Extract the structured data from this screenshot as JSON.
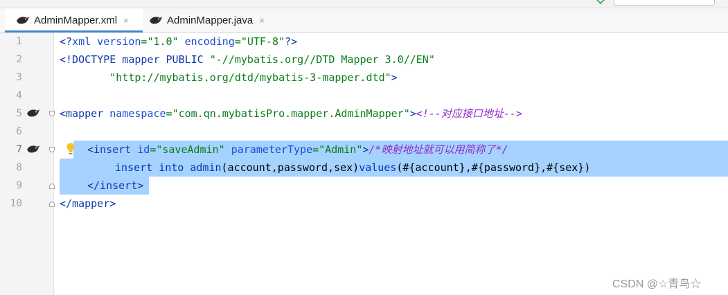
{
  "tabs": [
    {
      "label": "AdminMapper.xml",
      "active": true,
      "close": "×"
    },
    {
      "label": "AdminMapper.java",
      "active": false,
      "close": "×"
    }
  ],
  "top_widget": {
    "label": ""
  },
  "gutter": {
    "line_numbers": [
      "1",
      "2",
      "3",
      "4",
      "5",
      "6",
      "7",
      "8",
      "9",
      "10"
    ]
  },
  "code": {
    "l1": {
      "a": "<?",
      "b": "xml version",
      "c": "=",
      "d": "\"1.0\"",
      "e": " encoding",
      "f": "=",
      "g": "\"UTF-8\"",
      "h": "?>"
    },
    "l2": {
      "a": "<!DOCTYPE mapper PUBLIC ",
      "b": "\"-//mybatis.org//DTD Mapper 3.0//EN\""
    },
    "l3": {
      "a": "        ",
      "b": "\"http://mybatis.org/dtd/mybatis-3-mapper.dtd\"",
      "c": ">"
    },
    "l5": {
      "a": "<mapper",
      "b": " namespace",
      "c": "=",
      "d": "\"com.qn.mybatisPro.mapper.AdminMapper\"",
      "e": ">",
      "f": "<!--对应接口地址-->"
    },
    "l7": {
      "a": "<insert",
      "b": " id",
      "c": "=",
      "d": "\"saveAdmin\"",
      "e": " parameterType",
      "f": "=",
      "g": "\"Admin\"",
      "h": ">",
      "i": "/*映射地址就可以用简称了*/"
    },
    "l8": {
      "a": "insert",
      "b": " into ",
      "c": "admin",
      "d": "(account,password,sex)",
      "e": "values",
      "f": "(#{account},#{password},#{sex})"
    },
    "l9": {
      "a": "</insert>"
    },
    "l10": {
      "a": "</mapper>"
    }
  },
  "watermark": "CSDN @☆青鸟☆",
  "colors": {
    "selection": "#a6d2ff",
    "tag": "#0f37a8",
    "string": "#067d17",
    "tab_underline": "#4083c9"
  },
  "icons": [
    "mybatis-bird-icon",
    "close-icon",
    "lightbulb-icon",
    "fold-marker-icon"
  ]
}
